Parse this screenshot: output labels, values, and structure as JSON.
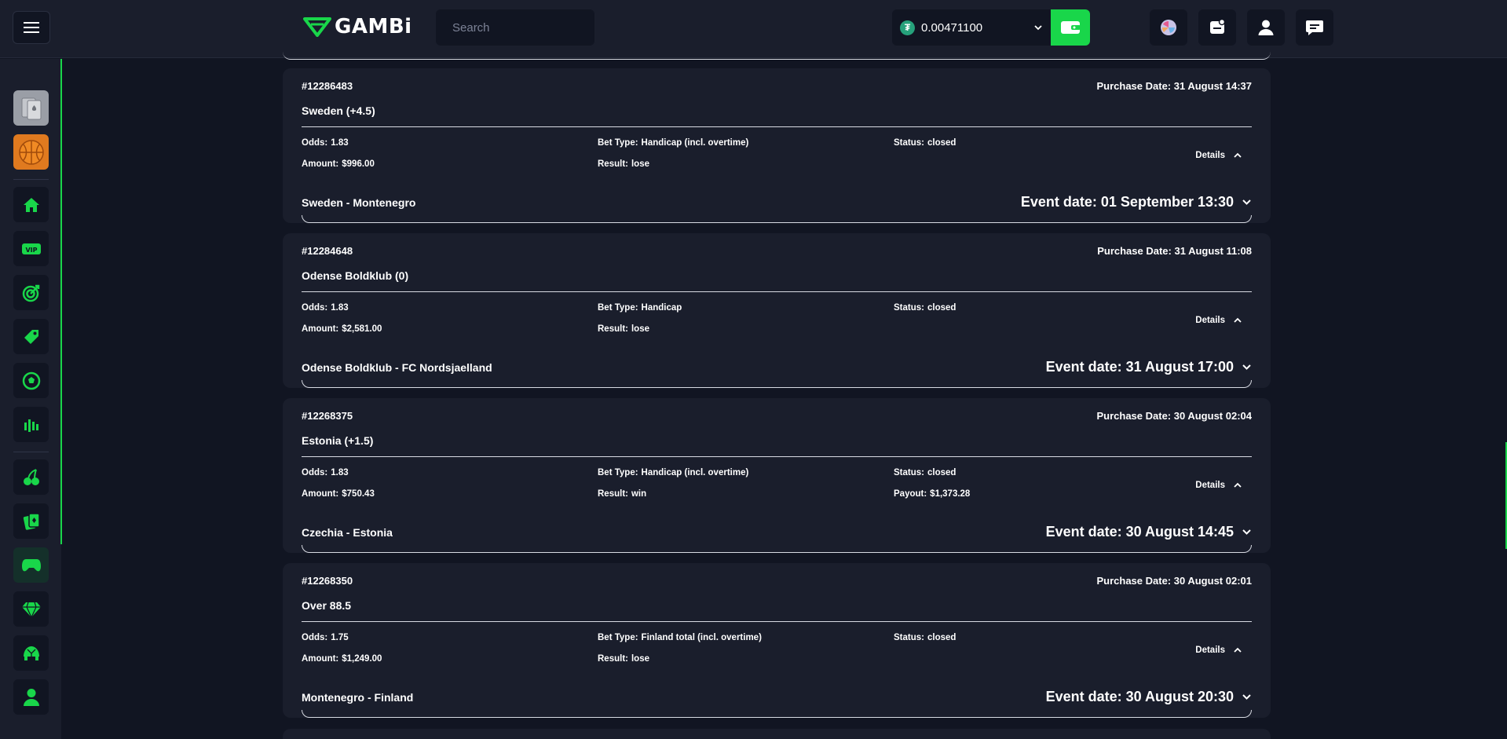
{
  "header": {
    "logo_text": "GAMBi",
    "search_placeholder": "Search",
    "balance": "0.00471100"
  },
  "colors": {
    "accent": "#19d64a",
    "background": "#111522",
    "panel": "#1a1e2c"
  },
  "sidebar": {
    "items": [
      {
        "icon": "cards-icon"
      },
      {
        "icon": "basketball-icon"
      },
      {
        "icon": "home-icon"
      },
      {
        "icon": "vip-icon"
      },
      {
        "icon": "target-icon"
      },
      {
        "icon": "tag-icon"
      },
      {
        "icon": "soccer-ball-icon"
      },
      {
        "icon": "chart-bars-icon"
      },
      {
        "icon": "cherries-icon"
      },
      {
        "icon": "playing-card-icon"
      },
      {
        "icon": "gamepad-icon"
      },
      {
        "icon": "diamond-icon"
      },
      {
        "icon": "turtle-icon"
      },
      {
        "icon": "user-icon"
      }
    ]
  },
  "labels": {
    "purchase": "Purchase Date:",
    "odds": "Odds:",
    "amount": "Amount:",
    "bet_type": "Bet Type:",
    "result": "Result:",
    "status": "Status:",
    "payout": "Payout:",
    "details": "Details",
    "event": "Event date:"
  },
  "bets": [
    {
      "id": "#12286483",
      "purchase_date": "31 August 14:37",
      "selection": "Sweden (+4.5)",
      "odds": "1.83",
      "amount": "$996.00",
      "bet_type": "Handicap (incl. overtime)",
      "result": "lose",
      "status": "closed",
      "payout": "",
      "match": "Sweden - Montenegro",
      "event_date": "01 September 13:30"
    },
    {
      "id": "#12284648",
      "purchase_date": "31 August 11:08",
      "selection": "Odense Boldklub (0)",
      "odds": "1.83",
      "amount": "$2,581.00",
      "bet_type": "Handicap",
      "result": "lose",
      "status": "closed",
      "payout": "",
      "match": "Odense Boldklub - FC Nordsjaelland",
      "event_date": "31 August 17:00"
    },
    {
      "id": "#12268375",
      "purchase_date": "30 August 02:04",
      "selection": "Estonia (+1.5)",
      "odds": "1.83",
      "amount": "$750.43",
      "bet_type": "Handicap (incl. overtime)",
      "result": "win",
      "status": "closed",
      "payout": "$1,373.28",
      "match": "Czechia - Estonia",
      "event_date": "30 August 14:45"
    },
    {
      "id": "#12268350",
      "purchase_date": "30 August 02:01",
      "selection": "Over 88.5",
      "odds": "1.75",
      "amount": "$1,249.00",
      "bet_type": "Finland total (incl. overtime)",
      "result": "lose",
      "status": "closed",
      "payout": "",
      "match": "Montenegro - Finland",
      "event_date": "30 August 20:30"
    }
  ]
}
